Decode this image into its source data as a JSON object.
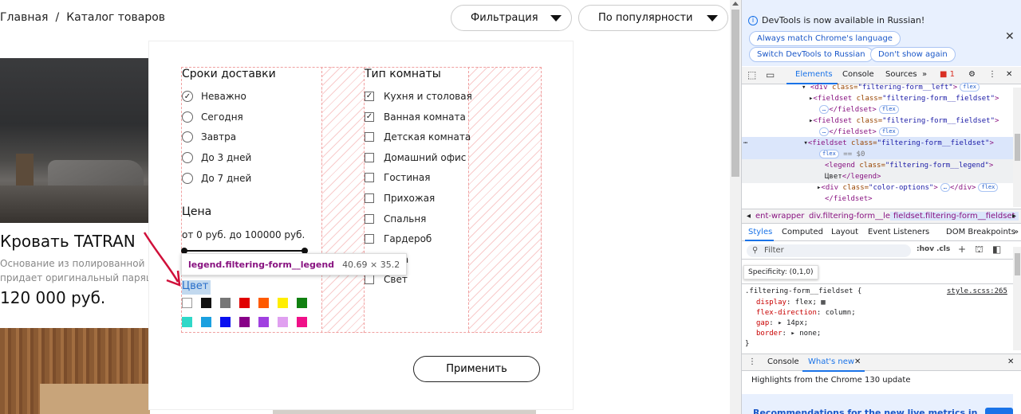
{
  "shop": {
    "breadcrumb": {
      "home": "Главная",
      "separator": "/",
      "current": "Каталог товаров"
    },
    "filter_button": "Фильтрация",
    "sort_button": "По популярности",
    "product": {
      "title": "Кровать TATRAN",
      "desc_line1": "Основание из полированной к",
      "desc_line2": "придает оригинальный парящ",
      "price": "120 000 руб."
    }
  },
  "modal": {
    "delivery": {
      "title": "Сроки доставки",
      "options": [
        {
          "label": "Неважно",
          "checked": true
        },
        {
          "label": "Сегодня",
          "checked": false
        },
        {
          "label": "Завтра",
          "checked": false
        },
        {
          "label": "До 3 дней",
          "checked": false
        },
        {
          "label": "До 7 дней",
          "checked": false
        }
      ]
    },
    "price": {
      "title": "Цена",
      "range_text": "от 0 руб. до 100000 руб."
    },
    "color": {
      "title": "Цвет",
      "swatches": [
        "#ffffff",
        "#111111",
        "#777777",
        "#e00000",
        "#ff5a00",
        "#ffee00",
        "#108010",
        "#30d8c8",
        "#1aa0e0",
        "#0a10f0",
        "#880088",
        "#a040e0",
        "#e0a0f0",
        "#f01088"
      ]
    },
    "room": {
      "title": "Тип комнаты",
      "options": [
        {
          "label": "Кухня и столовая",
          "checked": true
        },
        {
          "label": "Ванная комната",
          "checked": true
        },
        {
          "label": "Детская комната",
          "checked": false
        },
        {
          "label": "Домашний офис",
          "checked": false
        },
        {
          "label": "Гостиная",
          "checked": false
        },
        {
          "label": "Прихожая",
          "checked": false
        },
        {
          "label": "Спальня",
          "checked": false
        },
        {
          "label": "Гардероб",
          "checked": false
        },
        {
          "label": "Дача",
          "checked": false
        },
        {
          "label": "Свет",
          "checked": false
        }
      ]
    },
    "apply_button": "Применить",
    "inspector_tip": {
      "selector": "legend.filtering-form__legend",
      "size": "40.69 × 35.2"
    }
  },
  "devtools": {
    "info": {
      "message": "DevTools is now available in Russian!",
      "btn_always": "Always match Chrome's language",
      "btn_switch": "Switch DevTools to Russian",
      "btn_dont": "Don't show again"
    },
    "tabs": [
      "Elements",
      "Console",
      "Sources"
    ],
    "error_count": "1",
    "dom": {
      "line1_tag": "<div",
      "line1_attr": "class=",
      "line1_val": "\"filtering-form__left\"",
      "line1_end": ">",
      "fieldset_open": "<fieldset",
      "fieldset_attr": "class=",
      "fieldset_val": "\"filtering-form__fieldset\"",
      "fieldset_end": ">",
      "fieldset_close": "</fieldset>",
      "ellipsis": "…",
      "flex_badge": "flex",
      "eq0": "== $0",
      "legend_open": "<legend",
      "legend_attr": "class=",
      "legend_val": "\"filtering-form__legend\"",
      "legend_end": ">",
      "legend_text": "Цвет",
      "legend_close": "</legend>",
      "coloropt_open": "<div",
      "coloropt_attr": "class=",
      "coloropt_val": "\"color-options\"",
      "coloropt_end": ">",
      "coloropt_close": "</div>"
    },
    "crumbs": {
      "first": "ent-wrapper",
      "second": "div.filtering-form__left",
      "third": "fieldset.filtering-form__fieldset"
    },
    "subtabs": [
      "Styles",
      "Computed",
      "Layout",
      "Event Listeners",
      "DOM Breakpoints"
    ],
    "filter_placeholder": "Filter",
    "hov": ":hov",
    "cls": ".cls",
    "specificity": "Specificity: (0,1,0)",
    "rule": {
      "selector": ".filtering-form__fieldset {",
      "source": "style.scss:265",
      "p1_name": "display",
      "p1_val": "flex;",
      "p2_name": "flex-direction",
      "p2_val": "column;",
      "p3_name": "gap",
      "p3_val": "14px;",
      "p4_name": "border",
      "p4_val": "none;",
      "close": "}"
    },
    "drawer": {
      "console": "Console",
      "whats_new": "What's new"
    },
    "highlights": "Highlights from the Chrome 130 update",
    "promo": "Recommendations for the new live metrics in"
  },
  "colors": {
    "accent": "#1a73e8",
    "tag": "#881280",
    "attr": "#994500",
    "val": "#1a1aa6",
    "arrow": "#d0103a"
  }
}
